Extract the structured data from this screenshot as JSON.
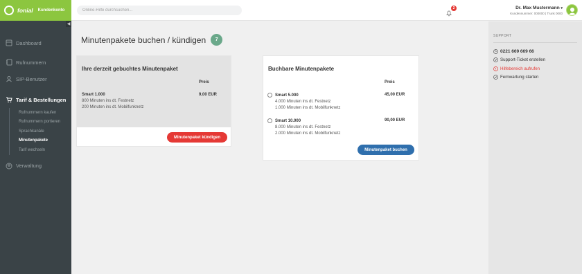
{
  "brand": {
    "name": "fonial",
    "subtitle": "Kundenkonto"
  },
  "search": {
    "placeholder": "Online-Hilfe durchsuchen..."
  },
  "notifications": {
    "count": "2"
  },
  "user": {
    "name": "Dr. Max Mustermann",
    "meta": "Kundennummer: 000000 | Trunk 0000"
  },
  "sidebar": {
    "items": [
      {
        "label": "Dashboard",
        "icon": "dashboard-icon"
      },
      {
        "label": "Rufnummern",
        "icon": "phone-book-icon"
      },
      {
        "label": "SIP-Benutzer",
        "icon": "users-icon"
      },
      {
        "label": "Tarif & Bestellungen",
        "icon": "cart-icon"
      },
      {
        "label": "Verwaltung",
        "icon": "user-circle-icon"
      }
    ],
    "subitems": [
      {
        "label": "Rufnummern kaufen"
      },
      {
        "label": "Rufnummern portieren"
      },
      {
        "label": "Sprachkanäle"
      },
      {
        "label": "Minutenpakete"
      },
      {
        "label": "Tarif wechseln"
      }
    ]
  },
  "page": {
    "title": "Minutenpakete buchen / kündigen",
    "count": "7"
  },
  "current": {
    "title": "Ihre derzeit gebuchtes Minutenpaket",
    "price_header": "Preis",
    "package": {
      "name": "Smart 1.000",
      "lines": [
        "800 Minuten ins dt. Festnetz",
        "200 Minuten ins dt. Mobilfunknetz"
      ],
      "price": "9,00 EUR"
    },
    "cancel_label": "Minutenpaket kündigen"
  },
  "bookable": {
    "title": "Buchbare Minutenpakete",
    "price_header": "Preis",
    "packages": [
      {
        "name": "Smart 5.000",
        "lines": [
          "4.000 Minuten ins dt. Festnetz",
          "1.000 Minuten ins dt. Mobilfunknetz"
        ],
        "price": "45,00 EUR"
      },
      {
        "name": "Smart 10.000",
        "lines": [
          "8.000 Minuten ins dt. Festnetz",
          "2.000 Minuten ins dt. Mobilfunknetz"
        ],
        "price": "90,00 EUR"
      }
    ],
    "book_label": "Minutenpaket buchen"
  },
  "support": {
    "header": "SUPPORT",
    "phone": "0221 669 669 66",
    "ticket": "Support-Ticket erstellen",
    "help": "Hilfebereich aufrufen",
    "remote": "Fernwartung starten"
  },
  "colors": {
    "brand": "#8cc63f",
    "danger": "#e53935",
    "primary": "#2f6fad",
    "badge": "#6aa88a"
  }
}
